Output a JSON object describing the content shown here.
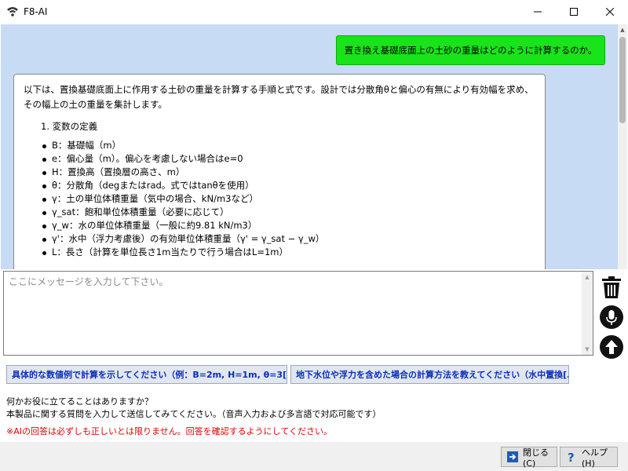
{
  "window": {
    "title": "F8-AI"
  },
  "chat": {
    "user_message": "置き換え基礎底面上の土砂の重量はどのように計算するのか。",
    "ai_intro": "以下は、置換基礎底面上に作用する土砂の重量を計算する手順と式です。設計では分散角θと偏心の有無により有効幅を求め、\nその幅上の土の重量を集計します。",
    "ai_numbered": "1. 変数の定義",
    "ai_items": [
      "B：基礎幅（m）",
      "e：偏心量（m）。偏心を考慮しない場合はe=0",
      "H：置換高（置換層の高さ、m）",
      "θ：分散角（degまたはrad。式ではtanθを使用）",
      "γ：土の単位体積重量（気中の場合、kN/m3など）",
      "γ_sat：飽和単位体積重量（必要に応じて）",
      "γ_w：水の単位体積重量（一般に約9.81 kN/m3）",
      "γ'：水中（浮力考慮後）の有効単位体積重量（γ' = γ_sat − γ_w）",
      "L：長さ（計算を単位長さ1m当たりで行う場合はL=1m）"
    ]
  },
  "input": {
    "placeholder": "ここにメッセージを入力して下さい。",
    "value": ""
  },
  "icons": {
    "trash": "trash-icon",
    "mic": "microphone-icon",
    "send": "arrow-up-icon"
  },
  "suggestions": [
    "具体的な数値例で計算を示してください（例：B=2m, H=1m, θ=3[…]",
    "地下水位や浮力を含めた場合の計算方法を教えてください（水中置換[…]"
  ],
  "info": {
    "line1": "何かお役に立てることはありますか？",
    "line2": "本製品に関する質問を入力して送信してみてください。（音声入力および多言語で対応可能です）",
    "warning": "※AIの回答は必ずしも正しいとは限りません。回答を確認するようにしてください。"
  },
  "buttons": {
    "close": "閉じる(C)",
    "help": "ヘルプ(H)"
  },
  "colors": {
    "chat_bg": "#c7dbf4",
    "user_bubble": "#19e319",
    "warning": "#e00000",
    "suggestion_text": "#0c2fb8"
  }
}
